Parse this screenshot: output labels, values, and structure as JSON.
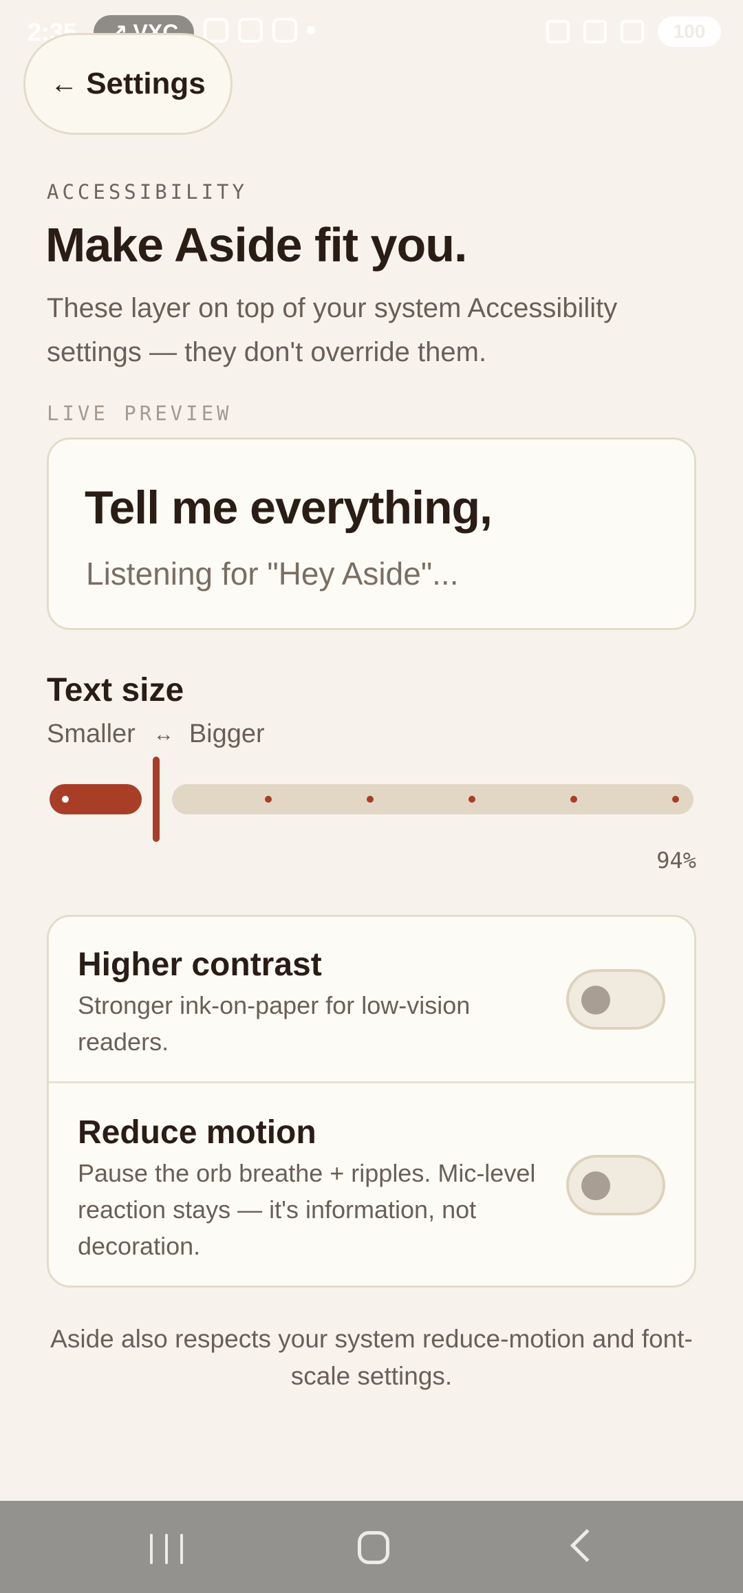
{
  "status_bar": {
    "time": "2:35",
    "pill_label": "VXC",
    "battery": "100",
    "icons_left": [
      "gmail-icon",
      "instagram-icon",
      "instagram-icon",
      "dot-icon"
    ],
    "icons_right": [
      "mute-icon",
      "wifi-icon",
      "signal-icon",
      "battery-icon"
    ]
  },
  "header": {
    "back_label": "Settings"
  },
  "section": {
    "eyebrow": "ACCESSIBILITY",
    "title": "Make Aside fit you.",
    "description": "These layer on top of your system Accessibility settings — they don't override them."
  },
  "preview": {
    "label": "LIVE PREVIEW",
    "headline": "Tell me everything,",
    "subline": "Listening for \"Hey Aside\"..."
  },
  "text_size": {
    "title": "Text size",
    "min_label": "Smaller",
    "max_label": "Bigger",
    "value": "94%",
    "slider_fraction": 0.0
  },
  "settings": [
    {
      "title": "Higher contrast",
      "description": "Stronger ink-on-paper for low-vision readers.",
      "enabled": false
    },
    {
      "title": "Reduce motion",
      "description": "Pause the orb breathe + ripples. Mic-level reaction stays — it's information, not decoration.",
      "enabled": false
    }
  ],
  "footer_note": "Aside also respects your system reduce-motion and font-scale settings.",
  "colors": {
    "background": "#f7f3ec",
    "accent": "#a93e27",
    "ink": "#2a1d16",
    "muted": "#6a5f56",
    "border": "#e3dcc9"
  }
}
